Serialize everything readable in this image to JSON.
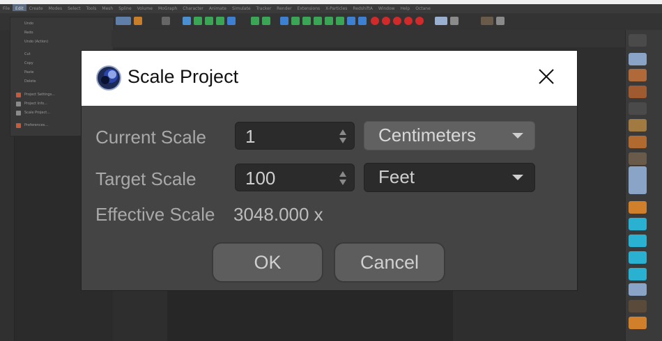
{
  "app": {
    "menubar": [
      "File",
      "Edit",
      "Create",
      "Modes",
      "Select",
      "Tools",
      "Mesh",
      "Spline",
      "Volume",
      "MoGraph",
      "Character",
      "Animate",
      "Simulate",
      "Tracker",
      "Render",
      "Extensions",
      "X-Particles",
      "RedshiftA",
      "Window",
      "Help",
      "Octane"
    ],
    "edit_menu_items": [
      "Undo",
      "Redo",
      "Undo (Action)",
      "Cut",
      "Copy",
      "Paste",
      "Delete",
      "Project Settings...",
      "Project Info...",
      "Scale Project...",
      "Preferences..."
    ]
  },
  "dialog": {
    "title": "Scale Project",
    "current_scale": {
      "label": "Current Scale",
      "value": "1",
      "unit": "Centimeters"
    },
    "target_scale": {
      "label": "Target Scale",
      "value": "100",
      "unit": "Feet"
    },
    "effective_scale": {
      "label": "Effective Scale",
      "value": "3048.000 x"
    },
    "ok_label": "OK",
    "cancel_label": "Cancel"
  }
}
